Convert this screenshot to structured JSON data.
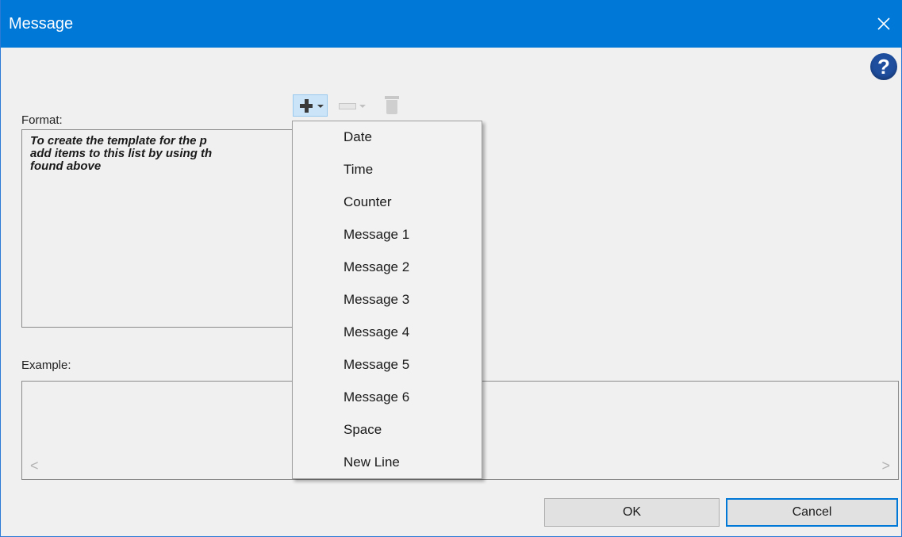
{
  "window": {
    "title": "Message",
    "close_glyph": "✕",
    "accent_color": "#0078d7"
  },
  "help": {
    "glyph": "?"
  },
  "format": {
    "label": "Format:",
    "hint": "To create the template for the p\nadd items to this list by using th\nfound above"
  },
  "toolbar": {
    "add_icon": "plus-icon",
    "remove_icon": "minus-icon",
    "delete_icon": "trash-icon"
  },
  "dropdown": {
    "items": [
      "Date",
      "Time",
      "Counter",
      "Message 1",
      "Message 2",
      "Message 3",
      "Message 4",
      "Message 5",
      "Message 6",
      "Space",
      "New Line"
    ]
  },
  "example": {
    "label": "Example:",
    "scroll_left": "<",
    "scroll_right": ">"
  },
  "buttons": {
    "ok": "OK",
    "cancel": "Cancel"
  }
}
